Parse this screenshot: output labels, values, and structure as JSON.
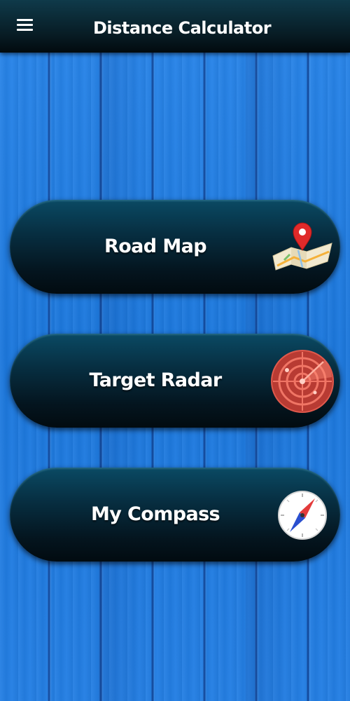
{
  "header": {
    "title": "Distance Calculator",
    "menu_icon": "hamburger-menu-icon"
  },
  "menu": {
    "items": [
      {
        "label": "Road Map",
        "icon": "road-map-icon"
      },
      {
        "label": "Target Radar",
        "icon": "radar-icon"
      },
      {
        "label": "My Compass",
        "icon": "compass-icon"
      }
    ]
  },
  "colors": {
    "background": "#1f7ee2",
    "header": "#071a22",
    "card": "#04151f",
    "map_pin": "#e02a2a",
    "radar": "#c8463b",
    "compass_red": "#e33b3b",
    "compass_blue": "#2a4fcf"
  }
}
